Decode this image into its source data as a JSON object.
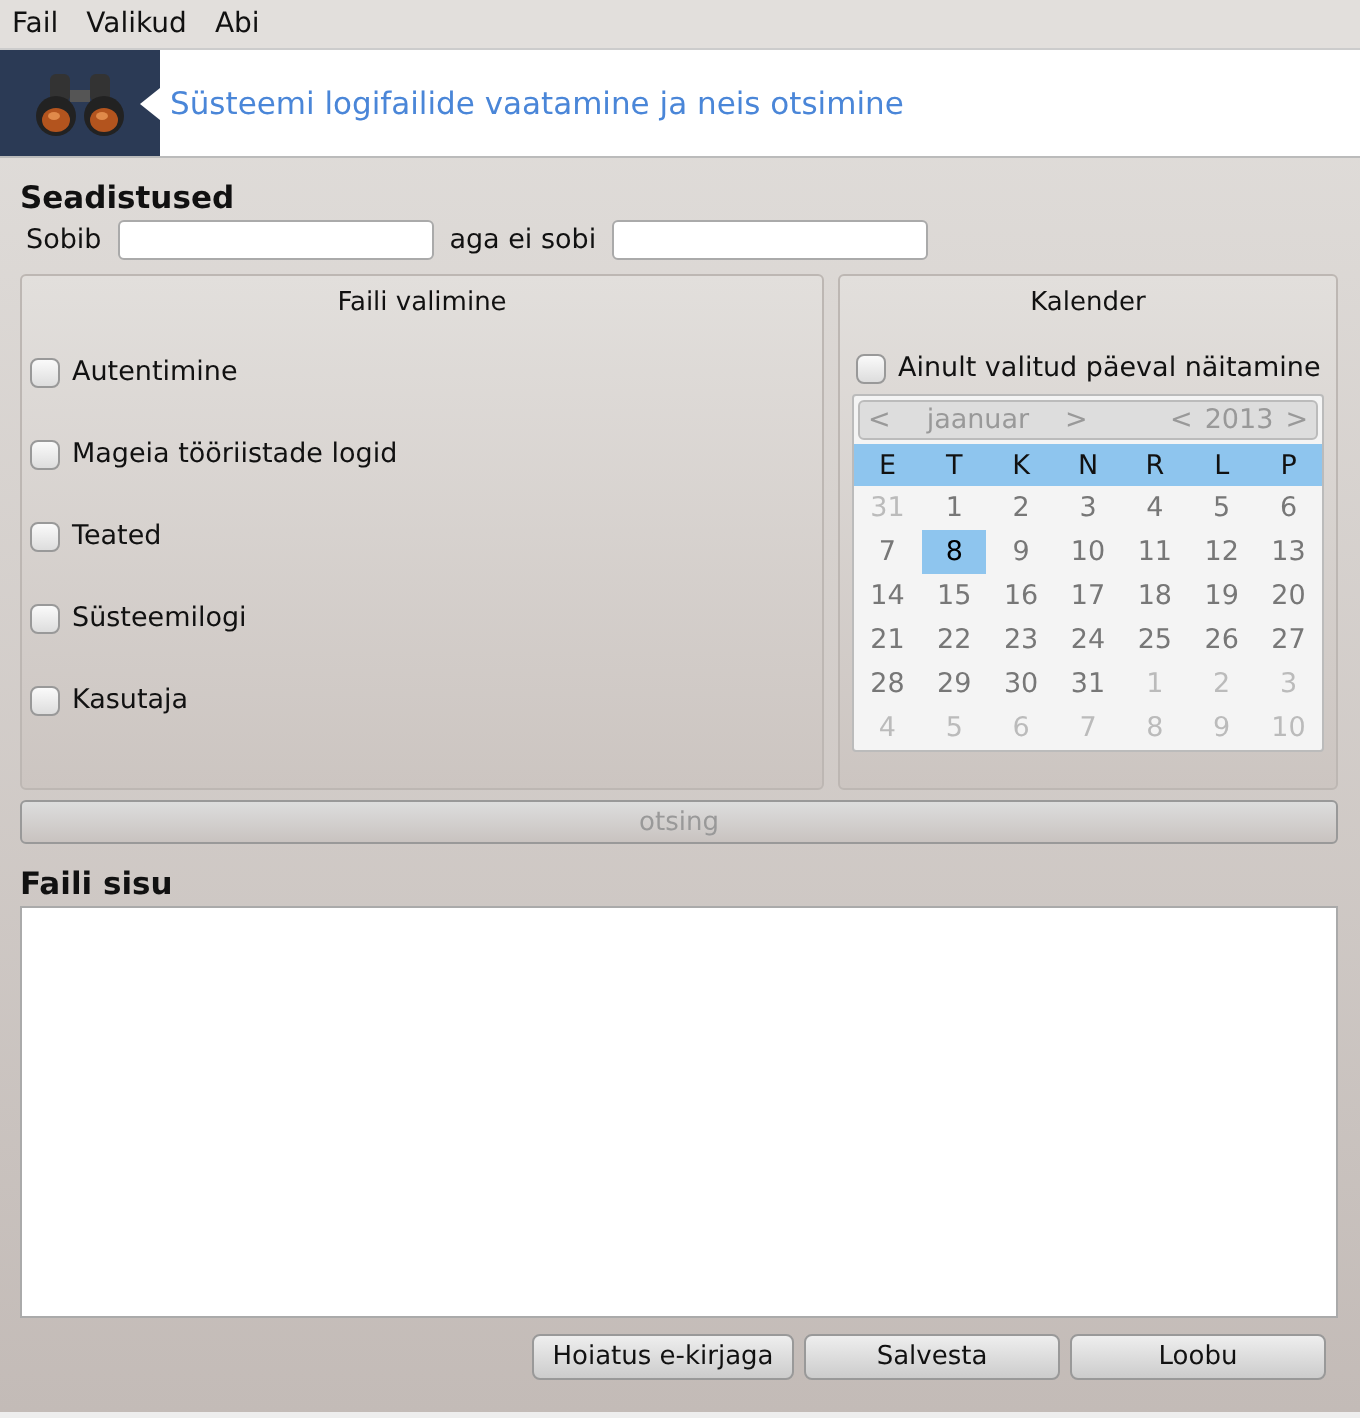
{
  "menu": [
    {
      "label": "Fail"
    },
    {
      "label": "Valikud"
    },
    {
      "label": "Abi"
    }
  ],
  "banner": {
    "title": "Süsteemi logifailide vaatamine ja neis otsimine"
  },
  "settings": {
    "title": "Seadistused",
    "match_label": "Sobib",
    "nomatch_label": "aga ei sobi"
  },
  "file_selection": {
    "title": "Faili valimine",
    "items": [
      {
        "label": "Autentimine",
        "checked": false
      },
      {
        "label": "Mageia tööriistade logid",
        "checked": false
      },
      {
        "label": "Teated",
        "checked": false
      },
      {
        "label": "Süsteemilogi",
        "checked": false
      },
      {
        "label": "Kasutaja",
        "checked": false
      }
    ]
  },
  "calendar": {
    "title": "Kalender",
    "only_selected": {
      "label": "Ainult valitud päeval näitamine",
      "checked": false
    },
    "month": "jaanuar",
    "year": "2013",
    "prev": "<",
    "next": ">",
    "nav_disabled": true,
    "weekdays": [
      "E",
      "T",
      "K",
      "N",
      "R",
      "L",
      "P"
    ],
    "days": [
      {
        "day": "31",
        "in_month": false,
        "selected": false
      },
      {
        "day": "1",
        "in_month": true,
        "selected": false
      },
      {
        "day": "2",
        "in_month": true,
        "selected": false
      },
      {
        "day": "3",
        "in_month": true,
        "selected": false
      },
      {
        "day": "4",
        "in_month": true,
        "selected": false
      },
      {
        "day": "5",
        "in_month": true,
        "selected": false
      },
      {
        "day": "6",
        "in_month": true,
        "selected": false
      },
      {
        "day": "7",
        "in_month": true,
        "selected": false
      },
      {
        "day": "8",
        "in_month": true,
        "selected": true
      },
      {
        "day": "9",
        "in_month": true,
        "selected": false
      },
      {
        "day": "10",
        "in_month": true,
        "selected": false
      },
      {
        "day": "11",
        "in_month": true,
        "selected": false
      },
      {
        "day": "12",
        "in_month": true,
        "selected": false
      },
      {
        "day": "13",
        "in_month": true,
        "selected": false
      },
      {
        "day": "14",
        "in_month": true,
        "selected": false
      },
      {
        "day": "15",
        "in_month": true,
        "selected": false
      },
      {
        "day": "16",
        "in_month": true,
        "selected": false
      },
      {
        "day": "17",
        "in_month": true,
        "selected": false
      },
      {
        "day": "18",
        "in_month": true,
        "selected": false
      },
      {
        "day": "19",
        "in_month": true,
        "selected": false
      },
      {
        "day": "20",
        "in_month": true,
        "selected": false
      },
      {
        "day": "21",
        "in_month": true,
        "selected": false
      },
      {
        "day": "22",
        "in_month": true,
        "selected": false
      },
      {
        "day": "23",
        "in_month": true,
        "selected": false
      },
      {
        "day": "24",
        "in_month": true,
        "selected": false
      },
      {
        "day": "25",
        "in_month": true,
        "selected": false
      },
      {
        "day": "26",
        "in_month": true,
        "selected": false
      },
      {
        "day": "27",
        "in_month": true,
        "selected": false
      },
      {
        "day": "28",
        "in_month": true,
        "selected": false
      },
      {
        "day": "29",
        "in_month": true,
        "selected": false
      },
      {
        "day": "30",
        "in_month": true,
        "selected": false
      },
      {
        "day": "31",
        "in_month": true,
        "selected": false
      },
      {
        "day": "1",
        "in_month": false,
        "selected": false
      },
      {
        "day": "2",
        "in_month": false,
        "selected": false
      },
      {
        "day": "3",
        "in_month": false,
        "selected": false
      },
      {
        "day": "4",
        "in_month": false,
        "selected": false
      },
      {
        "day": "5",
        "in_month": false,
        "selected": false
      },
      {
        "day": "6",
        "in_month": false,
        "selected": false
      },
      {
        "day": "7",
        "in_month": false,
        "selected": false
      },
      {
        "day": "8",
        "in_month": false,
        "selected": false
      },
      {
        "day": "9",
        "in_month": false,
        "selected": false
      },
      {
        "day": "10",
        "in_month": false,
        "selected": false
      }
    ]
  },
  "search_button": {
    "label": "otsing",
    "disabled": true
  },
  "content": {
    "title": "Faili sisu"
  },
  "buttons": [
    {
      "label": "Hoiatus e-kirjaga"
    },
    {
      "label": "Salvesta"
    },
    {
      "label": "Loobu"
    }
  ]
}
